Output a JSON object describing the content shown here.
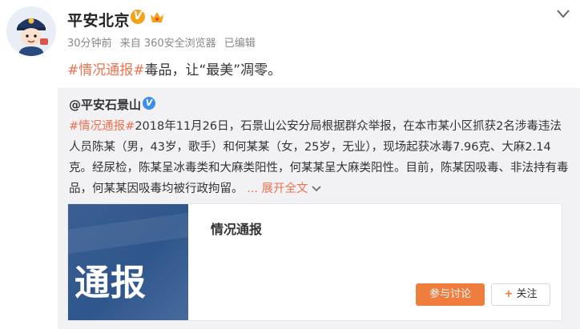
{
  "header": {
    "username": "平安北京",
    "verified": "V",
    "meta": {
      "time": "30分钟前",
      "source": "来自 360安全浏览器",
      "edited": "已编辑"
    }
  },
  "post": {
    "tag": "#情况通报#",
    "text": "毒品，让“最美”凋零。"
  },
  "repost": {
    "user": "@平安石景山",
    "verified": "V",
    "tag": "#情况通报#",
    "text": "2018年11月26日，石景山公安分局根据群众举报，在本市某小区抓获2名涉毒违法人员陈某（男，43岁，歌手）和何某某（女，25岁，无业），现场起获冰毒7.96克、大麻2.14克。经尿检，陈某呈冰毒类和大麻类阳性，何某某呈大麻类阳性。目前，陈某因吸毒、非法持有毒品，何某某因吸毒均被行政拘留。",
    "expand": "... 展开全文",
    "expand_icon": "chevron-down-icon",
    "article": {
      "thumb_text": "通报",
      "title": "情况通报",
      "discuss_label": "参与讨论",
      "follow_label": "关注"
    }
  },
  "colors": {
    "link": "#eb7350",
    "accent_button": "#f07c3e",
    "thumb": "#3b5f93"
  }
}
